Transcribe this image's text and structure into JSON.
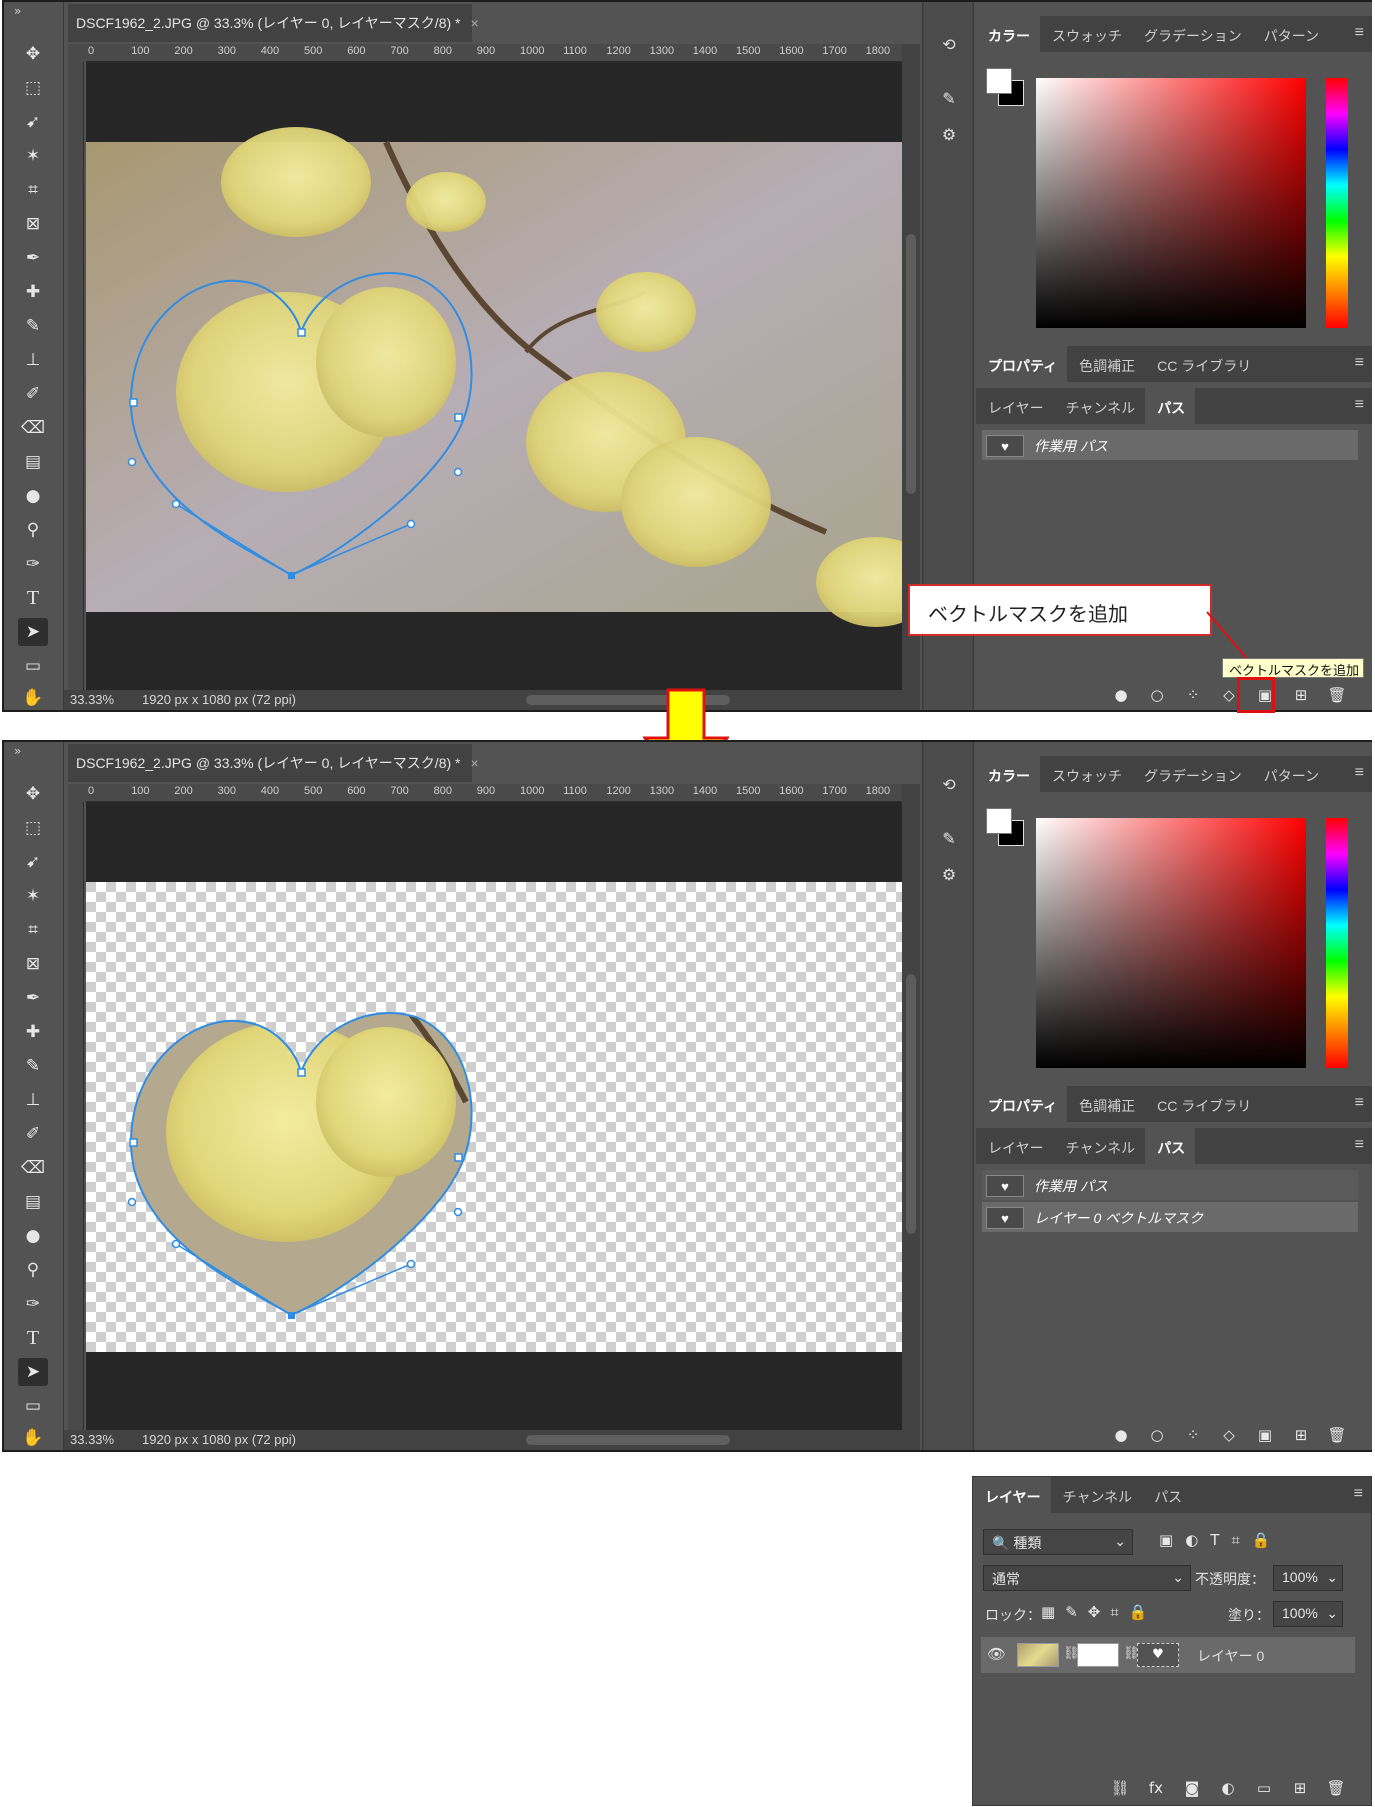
{
  "document": {
    "tab_title": "DSCF1962_2.JPG @ 33.3% (レイヤー 0, レイヤーマスク/8) *",
    "close": "×",
    "zoom": "33.33%",
    "dimensions": "1920 px x 1080 px (72 ppi)"
  },
  "toolbar": {
    "collapse": "»",
    "tools": [
      "move-tool",
      "marquee-tool",
      "lasso-tool",
      "magic-wand-tool",
      "crop-tool",
      "frame-tool",
      "eyedropper-tool",
      "healing-brush-tool",
      "brush-tool",
      "clone-stamp-tool",
      "history-brush-tool",
      "eraser-tool",
      "gradient-tool",
      "blur-tool",
      "dodge-tool",
      "pen-tool",
      "type-tool",
      "path-selection-tool",
      "rectangle-tool",
      "hand-tool"
    ],
    "type_glyph": "T"
  },
  "ruler": {
    "ticks": [
      "0",
      "100",
      "200",
      "300",
      "400",
      "500",
      "600",
      "700",
      "800",
      "900",
      "1000",
      "1100",
      "1200",
      "1300",
      "1400",
      "1500",
      "1600",
      "1700",
      "1800"
    ]
  },
  "color_panel": {
    "tabs": [
      "カラー",
      "スウォッチ",
      "グラデーション",
      "パターン"
    ],
    "menu": "≡",
    "fg": "#ffffff",
    "bg": "#000000"
  },
  "props_panel": {
    "tabs": [
      "プロパティ",
      "色調補正",
      "CC ライブラリ"
    ]
  },
  "paths_panel": {
    "tabs": [
      "レイヤー",
      "チャンネル",
      "パス"
    ],
    "before_rows": [
      "作業用 パス"
    ],
    "after_rows": [
      "作業用 パス",
      "レイヤー 0 ベクトルマスク"
    ],
    "thumb": "♥"
  },
  "paths_icons": [
    "●",
    "○",
    "⁘",
    "◇",
    "▣",
    "⊞",
    "🗑"
  ],
  "annotation": {
    "callout": "ベクトルマスクを追加",
    "tooltip": "ベクトルマスクを追加",
    "arrow_color": "#ffff00"
  },
  "layers_panel": {
    "tabs": [
      "レイヤー",
      "チャンネル",
      "パス"
    ],
    "filter": "種類",
    "blend": "通常",
    "opacity_label": "不透明度：",
    "opacity": "100%",
    "lock_label": "ロック：",
    "fill_label": "塗り：",
    "fill": "100%",
    "layer_name": "レイヤー 0",
    "filter_icons": [
      "▣",
      "◐",
      "T",
      "⌗",
      "🔒"
    ],
    "lock_icons": [
      "▦",
      "✎",
      "✥",
      "⌗",
      "🔒"
    ],
    "bottom_icons": [
      "⛓",
      "fx",
      "◙",
      "◐",
      "▭",
      "⊞",
      "🗑"
    ]
  },
  "colors": {
    "accent": "#2f8de4",
    "panel": "#535353",
    "dark": "#262626"
  }
}
